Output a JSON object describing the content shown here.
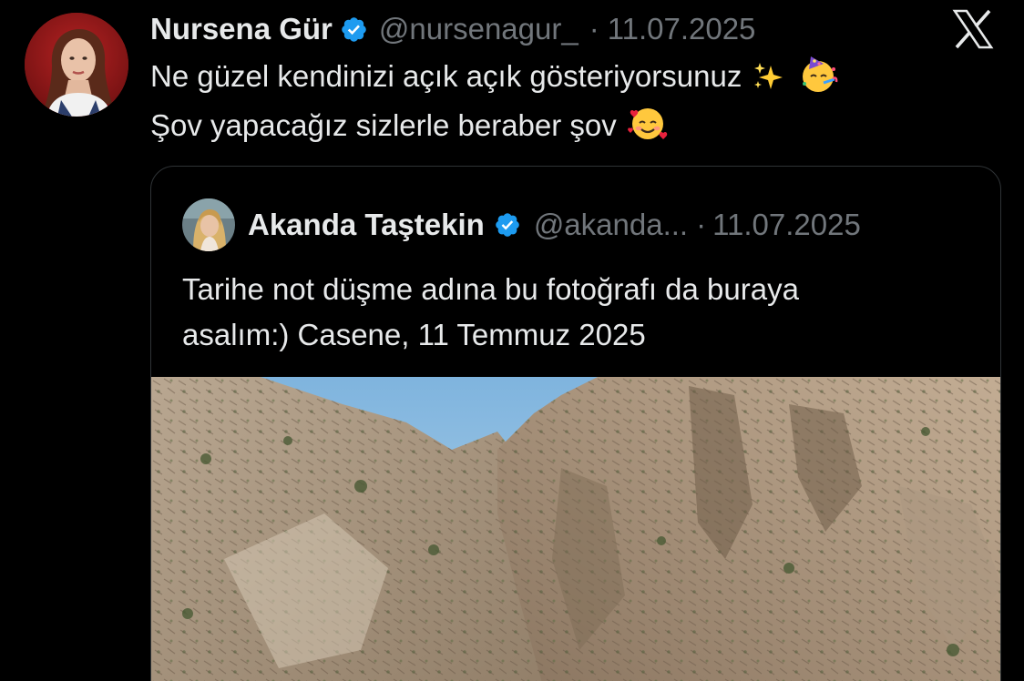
{
  "tweet": {
    "author": {
      "display_name": "Nursena Gür",
      "handle": "@nursenagur_",
      "verified_icon": "verified-badge-icon"
    },
    "separator": "·",
    "date": "11.07.2025",
    "platform_logo": "X",
    "text_lines": [
      "Ne güzel kendinizi açık açık gösteriyorsunuz",
      "Şov yapacağız sizlerle beraber şov"
    ],
    "emojis": {
      "line1": [
        "sparkles",
        "partying-face"
      ],
      "line2": [
        "smiling-face-with-hearts"
      ]
    }
  },
  "quoted_tweet": {
    "author": {
      "display_name": "Akanda Taştekin",
      "handle": "@akanda...",
      "verified_icon": "verified-badge-icon"
    },
    "separator": "·",
    "date": "11.07.2025",
    "text_lines": [
      "Tarihe not düşme adına bu fotoğrafı da buraya",
      "asalım:) Casene, 11 Temmuz 2025"
    ],
    "media": {
      "type": "photo",
      "subject": "rocky canyon cliffs with blue sky"
    }
  },
  "colors": {
    "background": "#000000",
    "primary_text": "#e7e9ea",
    "secondary_text": "#71767b",
    "border": "#2f3336",
    "verified_blue": "#1d9bf0"
  }
}
